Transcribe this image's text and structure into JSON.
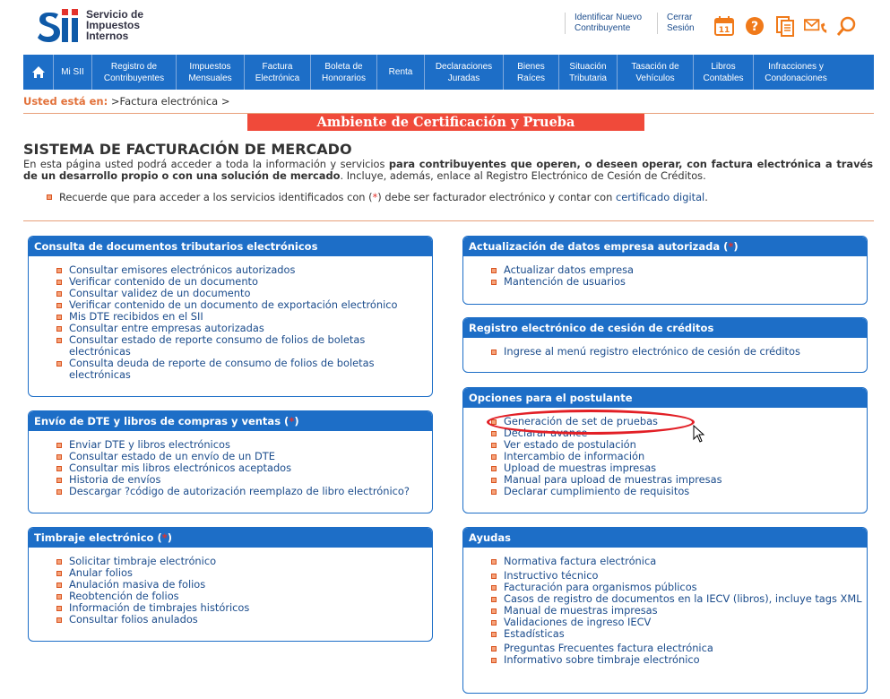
{
  "header": {
    "logo_line1": "Servicio de",
    "logo_line2": "Impuestos",
    "logo_line3": "Internos",
    "link_identify_1": "Identificar Nuevo",
    "link_identify_2": "Contribuyente",
    "link_close_1": "Cerrar",
    "link_close_2": "Sesión",
    "calendar_day": "11"
  },
  "nav": {
    "items": [
      {
        "l1": "Mi SII",
        "l2": ""
      },
      {
        "l1": "Registro de",
        "l2": "Contribuyentes"
      },
      {
        "l1": "Impuestos",
        "l2": "Mensuales"
      },
      {
        "l1": "Factura",
        "l2": "Electrónica"
      },
      {
        "l1": "Boleta de",
        "l2": "Honorarios"
      },
      {
        "l1": "Renta",
        "l2": ""
      },
      {
        "l1": "Declaraciones",
        "l2": "Juradas"
      },
      {
        "l1": "Bienes",
        "l2": "Raíces"
      },
      {
        "l1": "Situación",
        "l2": "Tributaria"
      },
      {
        "l1": "Tasación de",
        "l2": "Vehículos"
      },
      {
        "l1": "Libros",
        "l2": "Contables"
      },
      {
        "l1": "Infracciones y",
        "l2": "Condonaciones"
      }
    ]
  },
  "breadcrumb": {
    "label": "Usted está en:",
    "path": " >Factura electrónica >"
  },
  "banner": "Ambiente de Certificación y Prueba",
  "title": "SISTEMA DE FACTURACIÓN DE MERCADO",
  "intro": {
    "p1": "En esta página usted podrá acceder a toda la información y servicios ",
    "bold1": "para contribuyentes que operen, o deseen operar, con factura electrónica a través de un desarrollo propio o con una solución de mercado",
    "p2": ". Incluye, además, enlace al Registro Electrónico de Cesión de Créditos."
  },
  "note": {
    "pre": "Recuerde que para acceder a los servicios identificados con (",
    "star": "*",
    "mid": ") debe ser facturador electrónico y contar con ",
    "link": "certificado digital",
    "post": "."
  },
  "panels": {
    "consulta": {
      "title": "Consulta de documentos tributarios electrónicos",
      "items": [
        "Consultar emisores electrónicos autorizados",
        "Verificar contenido de un documento",
        "Consultar validez de un documento",
        "Verificar contenido de un documento de exportación electrónico",
        "Mis DTE recibidos en el SII",
        "Consultar entre empresas autorizadas",
        "Consultar estado de reporte consumo de folios de boletas electrónicas",
        "Consulta deuda de reporte de consumo de folios de boletas electrónicas"
      ]
    },
    "envio": {
      "title": "Envío de DTE y libros de compras y ventas (",
      "title_star": "*",
      "title_end": ")",
      "items": [
        "Enviar DTE y libros electrónicos",
        "Consultar estado de un envío de un DTE",
        "Consultar mis libros electrónicos aceptados",
        "Historia de envíos",
        "Descargar ?código de autorización reemplazo de libro electrónico?"
      ]
    },
    "timbraje": {
      "title": "Timbraje electrónico (",
      "title_star": "*",
      "title_end": ")",
      "items": [
        "Solicitar timbraje electrónico",
        "Anular folios",
        "Anulación masiva de folios",
        "Reobtención de folios",
        "Información de timbrajes históricos",
        "Consultar folios anulados"
      ]
    },
    "actualizacion": {
      "title": "Actualización de datos empresa autorizada (",
      "title_star": "*",
      "title_end": ")",
      "items": [
        "Actualizar datos empresa",
        "Mantención de usuarios"
      ]
    },
    "registro": {
      "title": "Registro electrónico de cesión de créditos",
      "items": [
        "Ingrese al menú registro electrónico de cesión de créditos"
      ]
    },
    "postulante": {
      "title": "Opciones para el postulante",
      "items": [
        "Generación de set de pruebas",
        "Declarar avance",
        "Ver estado de postulación",
        "Intercambio de información",
        "Upload de muestras impresas",
        "Manual para upload de muestras impresas",
        "Declarar cumplimiento de requisitos"
      ]
    },
    "ayudas": {
      "title": "Ayudas",
      "items": [
        "Normativa factura electrónica",
        "Instructivo técnico",
        "Facturación para organismos públicos",
        "Casos de registro de documentos en la IECV (libros), incluye tags XML",
        "Manual de muestras impresas",
        "Validaciones de ingreso IECV",
        "Estadísticas",
        "Preguntas Frecuentes factura electrónica",
        "Informativo sobre timbraje electrónico"
      ]
    }
  }
}
